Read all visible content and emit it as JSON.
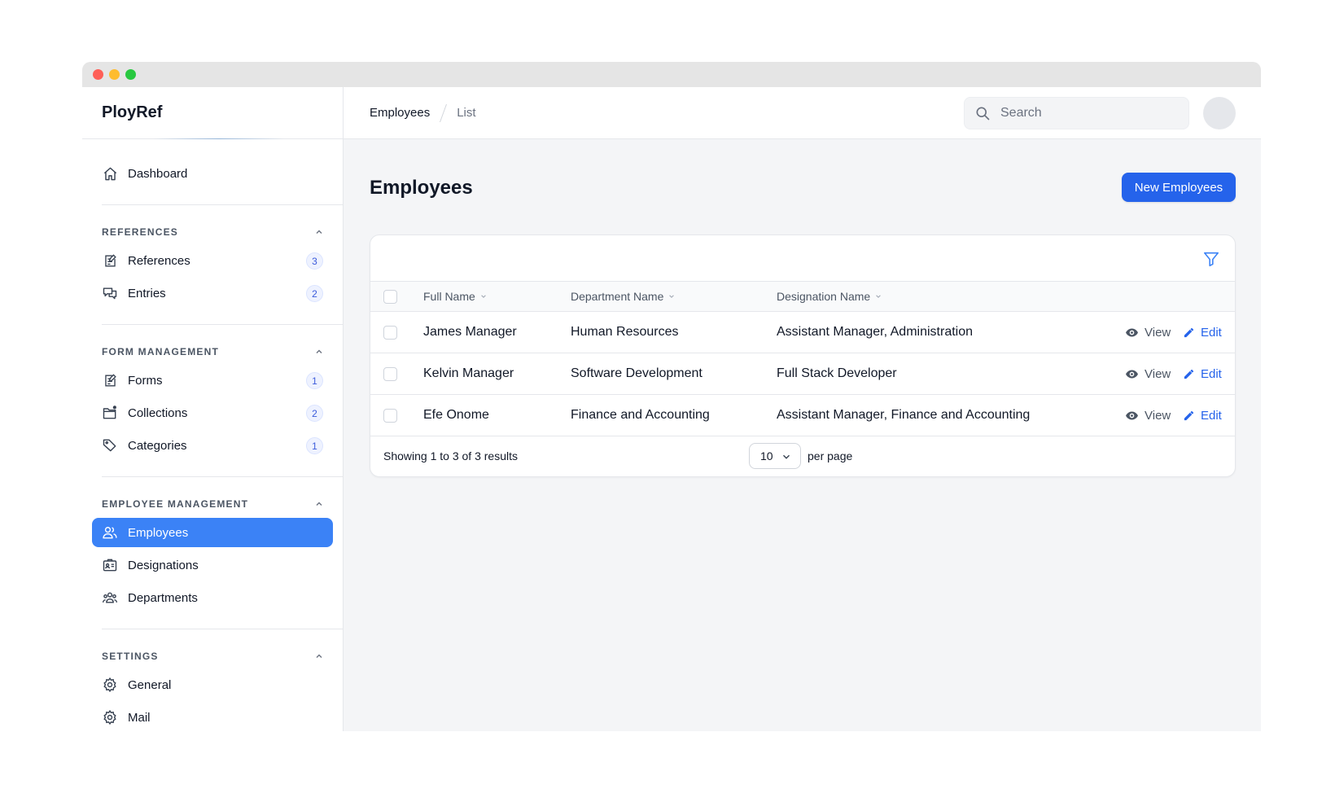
{
  "sidebar": {
    "brand": "PloyRef",
    "dashboard": "Dashboard",
    "sections": [
      {
        "title": "REFERENCES",
        "items": [
          {
            "label": "References",
            "badge": "3"
          },
          {
            "label": "Entries",
            "badge": "2"
          }
        ]
      },
      {
        "title": "FORM MANAGEMENT",
        "items": [
          {
            "label": "Forms",
            "badge": "1"
          },
          {
            "label": "Collections",
            "badge": "2"
          },
          {
            "label": "Categories",
            "badge": "1"
          }
        ]
      },
      {
        "title": "EMPLOYEE MANAGEMENT",
        "items": [
          {
            "label": "Employees"
          },
          {
            "label": "Designations"
          },
          {
            "label": "Departments"
          }
        ]
      },
      {
        "title": "SETTINGS",
        "items": [
          {
            "label": "General"
          },
          {
            "label": "Mail"
          }
        ]
      }
    ]
  },
  "topbar": {
    "crumb1": "Employees",
    "crumb2": "List",
    "search_placeholder": "Search"
  },
  "page": {
    "title": "Employees",
    "new_button": "New Employees"
  },
  "table": {
    "headers": [
      "Full Name",
      "Department Name",
      "Designation Name"
    ],
    "rows": [
      {
        "name": "James Manager",
        "department": "Human Resources",
        "designation": "Assistant Manager, Administration"
      },
      {
        "name": "Kelvin Manager",
        "department": "Software Development",
        "designation": "Full Stack Developer"
      },
      {
        "name": "Efe Onome",
        "department": "Finance and Accounting",
        "designation": "Assistant Manager, Finance and Accounting"
      }
    ],
    "view_label": "View",
    "edit_label": "Edit",
    "showing": "Showing 1 to 3 of 3 results",
    "per_page_value": "10",
    "per_page_label": "per page"
  },
  "colors": {
    "accent": "#2563eb",
    "active_nav": "#3b82f6"
  }
}
